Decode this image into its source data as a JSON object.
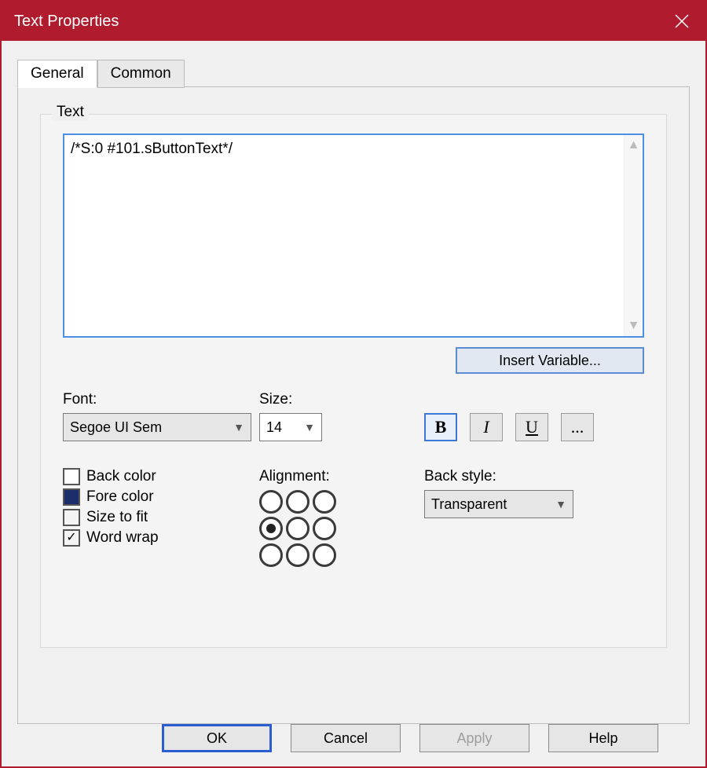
{
  "window": {
    "title": "Text Properties"
  },
  "tabs": {
    "general": "General",
    "common": "Common"
  },
  "group": {
    "text_legend": "Text",
    "text_value": "/*S:0 #101.sButtonText*/",
    "insert_variable": "Insert Variable..."
  },
  "font": {
    "label": "Font:",
    "value": "Segoe UI Sem"
  },
  "size": {
    "label": "Size:",
    "value": "14"
  },
  "style": {
    "bold": "B",
    "italic": "I",
    "underline": "U",
    "more": "..."
  },
  "checks": {
    "back_color": "Back color",
    "fore_color": "Fore color",
    "size_to_fit": "Size to fit",
    "word_wrap": "Word wrap"
  },
  "alignment": {
    "label": "Alignment:"
  },
  "back_style": {
    "label": "Back style:",
    "value": "Transparent"
  },
  "buttons": {
    "ok": "OK",
    "cancel": "Cancel",
    "apply": "Apply",
    "help": "Help"
  }
}
